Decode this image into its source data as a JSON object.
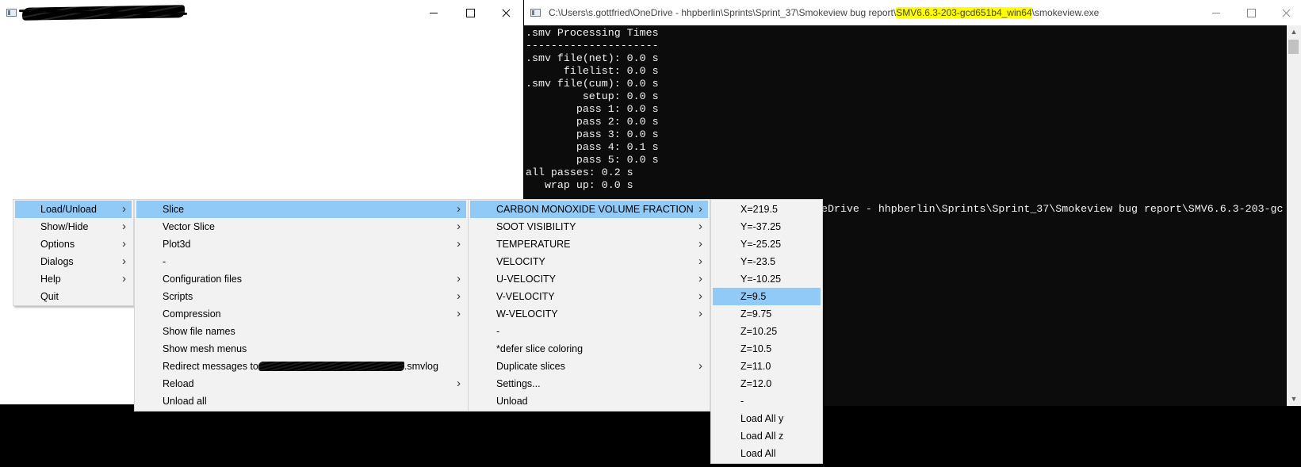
{
  "console_window": {
    "title_prefix": "C:\\Users\\s.gottfried\\OneDrive - hhpberlin\\Sprints\\Sprint_37\\Smokeview bug report\\",
    "title_highlight": "SMV6.6.3-203-gcd651b4_win64",
    "title_suffix": "\\smokeview.exe",
    "highlight_color": "#ffff00",
    "lines": [
      ".smv Processing Times",
      "---------------------",
      ".smv file(net): 0.0 s",
      "      filelist: 0.0 s",
      ".smv file(cum): 0.0 s",
      "         setup: 0.0 s",
      "        pass 1: 0.0 s",
      "        pass 2: 0.0 s",
      "        pass 3: 0.0 s",
      "        pass 4: 0.1 s",
      "        pass 5: 0.0 s",
      "all passes: 0.2 s",
      "   wrap up: 0.0 s"
    ],
    "partial_line": "eDrive - hhpberlin\\Sprints\\Sprint_37\\Smokeview bug report\\SMV6.6.3-203-gc"
  },
  "menus": {
    "main": [
      {
        "label": "Load/Unload",
        "submenu": true,
        "active": true
      },
      {
        "label": "Show/Hide",
        "submenu": true
      },
      {
        "label": "Options",
        "submenu": true
      },
      {
        "label": "Dialogs",
        "submenu": true
      },
      {
        "label": "Help",
        "submenu": true
      },
      {
        "label": "Quit",
        "submenu": false
      }
    ],
    "load_unload": [
      {
        "label": "Slice",
        "submenu": true,
        "active": true
      },
      {
        "label": "Vector Slice",
        "submenu": true
      },
      {
        "label": "Plot3d",
        "submenu": true
      },
      {
        "label": "-",
        "submenu": false
      },
      {
        "label": "Configuration files",
        "submenu": true
      },
      {
        "label": "Scripts",
        "submenu": true
      },
      {
        "label": "Compression",
        "submenu": true
      },
      {
        "label": "Show file names",
        "submenu": false
      },
      {
        "label": "Show mesh menus",
        "submenu": false
      },
      {
        "label": "Redirect messages to",
        "suffix": ".smvlog",
        "redacted": true,
        "submenu": false
      },
      {
        "label": "Reload",
        "submenu": true
      },
      {
        "label": "Unload all",
        "submenu": false
      }
    ],
    "slice": [
      {
        "label": "CARBON MONOXIDE VOLUME FRACTION",
        "submenu": true,
        "active": true
      },
      {
        "label": "SOOT VISIBILITY",
        "submenu": true
      },
      {
        "label": "TEMPERATURE",
        "submenu": true
      },
      {
        "label": "VELOCITY",
        "submenu": true
      },
      {
        "label": "U-VELOCITY",
        "submenu": true
      },
      {
        "label": "V-VELOCITY",
        "submenu": true
      },
      {
        "label": "W-VELOCITY",
        "submenu": true
      },
      {
        "label": "-",
        "submenu": false
      },
      {
        "label": " *defer slice coloring",
        "submenu": false
      },
      {
        "label": "Duplicate slices",
        "submenu": true
      },
      {
        "label": "Settings...",
        "submenu": false
      },
      {
        "label": "Unload",
        "submenu": false
      }
    ],
    "co_slices": [
      {
        "label": "X=219.5"
      },
      {
        "label": "Y=-37.25"
      },
      {
        "label": "Y=-25.25"
      },
      {
        "label": "Y=-23.5"
      },
      {
        "label": "Y=-10.25"
      },
      {
        "label": "Z=9.5",
        "active": true
      },
      {
        "label": "Z=9.75"
      },
      {
        "label": "Z=10.25"
      },
      {
        "label": "Z=10.5"
      },
      {
        "label": "Z=11.0"
      },
      {
        "label": "Z=12.0"
      },
      {
        "label": "-"
      },
      {
        "label": "Load All y"
      },
      {
        "label": "Load All z"
      },
      {
        "label": "Load All"
      }
    ]
  },
  "colors": {
    "menu_bg": "#f2f2f2",
    "menu_highlight": "#91c9f7",
    "console_bg": "#0c0c0c",
    "console_text": "#f2f2f2"
  }
}
